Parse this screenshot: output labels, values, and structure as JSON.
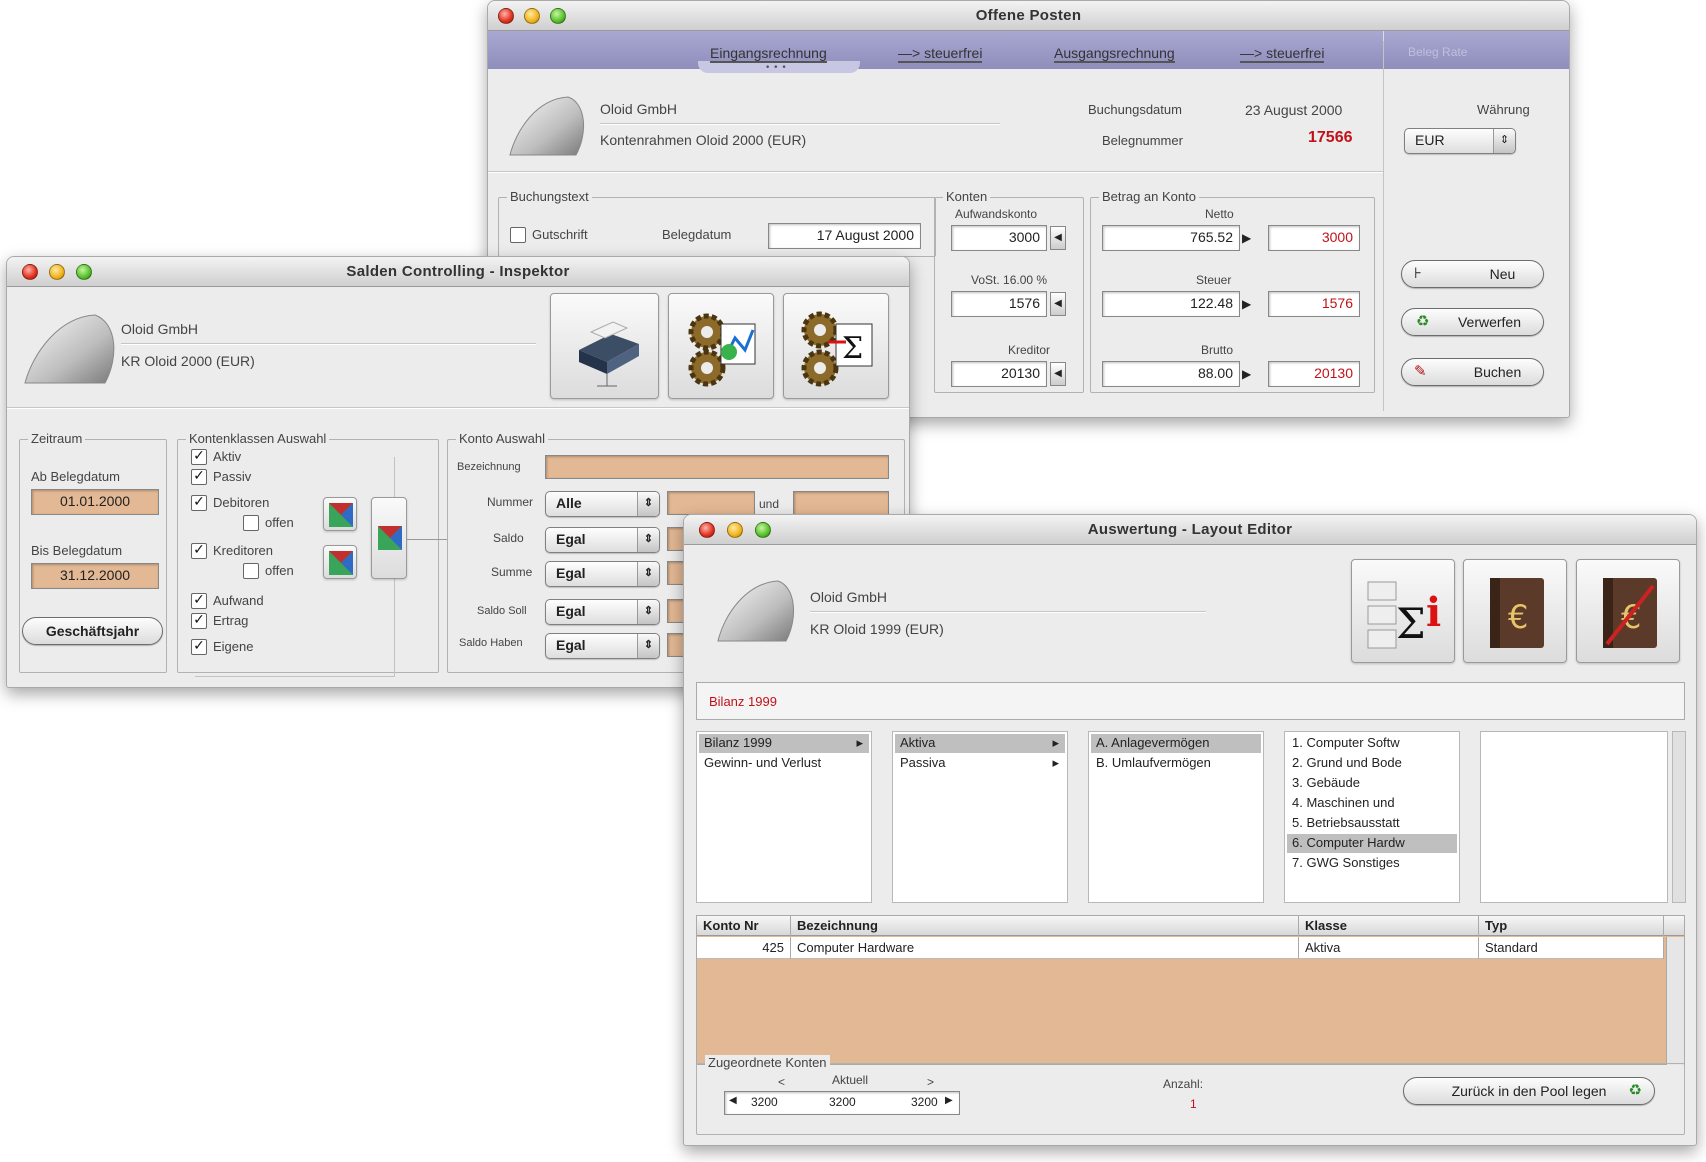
{
  "win1": {
    "title": "Offene Posten",
    "tabs": [
      "Eingangsrechnung",
      "—> steuerfrei",
      "Ausgangsrechnung",
      "—> steuerfrei"
    ],
    "tab_dim": "Beleg Rate",
    "tab_dots": "• • •",
    "company": "Oloid GmbH",
    "account_frame": "Kontenrahmen Oloid 2000 (EUR)",
    "booking_date_label": "Buchungsdatum",
    "booking_date": "23 August 2000",
    "doc_no_label": "Belegnummer",
    "doc_no": "17566",
    "currency_label": "Währung",
    "currency": "EUR",
    "buchungstext_label": "Buchungstext",
    "gutschrift_label": "Gutschrift",
    "belegdatum_label": "Belegdatum",
    "belegdatum": "17 August 2000",
    "konten_label": "Konten",
    "aufwandskonto_label": "Aufwandskonto",
    "aufwandskonto": "3000",
    "vorst_label": "VoSt. 16.00 %",
    "vorst": "1576",
    "kreditor_label": "Kreditor",
    "kreditor": "20130",
    "betrag_label": "Betrag an Konto",
    "netto_label": "Netto",
    "netto": "765.52",
    "netto_konto": "3000",
    "steuer_label": "Steuer",
    "steuer": "122.48",
    "steuer_konto": "1576",
    "brutto_label": "Brutto",
    "brutto": "88.00",
    "brutto_konto": "20130",
    "btn_neu": "Neu",
    "btn_verwerfen": "Verwerfen",
    "btn_buchen": "Buchen"
  },
  "win2": {
    "title": "Salden Controlling - Inspektor",
    "company": "Oloid GmbH",
    "account_frame": "KR Oloid 2000 (EUR)",
    "zeitraum_label": "Zeitraum",
    "ab_label": "Ab Belegdatum",
    "ab_value": "01.01.2000",
    "bis_label": "Bis Belegdatum",
    "bis_value": "31.12.2000",
    "btn_geschaeftsjahr": "Geschäftsjahr",
    "klassen_label": "Kontenklassen Auswahl",
    "chk_aktiv": "Aktiv",
    "chk_passiv": "Passiv",
    "chk_debitoren": "Debitoren",
    "chk_offen1": "offen",
    "chk_kreditoren": "Kreditoren",
    "chk_offen2": "offen",
    "chk_aufwand": "Aufwand",
    "chk_ertrag": "Ertrag",
    "chk_eigene": "Eigene",
    "konto_label": "Konto Auswahl",
    "bezeichnung_label": "Bezeichnung",
    "nummer_label": "Nummer",
    "nummer_popup": "Alle",
    "und_label": "und",
    "saldo_label": "Saldo",
    "saldo_popup": "Egal",
    "summe_label": "Summe",
    "summe_popup": "Egal",
    "saldo_soll_label": "Saldo Soll",
    "saldo_soll_popup": "Egal",
    "saldo_haben_label": "Saldo Haben",
    "saldo_haben_popup": "Egal"
  },
  "win3": {
    "title": "Auswertung - Layout Editor",
    "company": "Oloid GmbH",
    "account_frame": "KR Oloid 1999 (EUR)",
    "report_name": "Bilanz 1999",
    "col1": [
      "Bilanz 1999",
      "Gewinn- und Verlust"
    ],
    "col2": [
      "Aktiva",
      "Passiva"
    ],
    "col3": [
      "A.  Anlagevermögen",
      "B.  Umlaufvermögen"
    ],
    "col4": [
      "1.  Computer Softw",
      "2.  Grund und Bode",
      "3.  Gebäude",
      "4.  Maschinen und",
      "5.  Betriebsausstatt",
      "6.  Computer Hardw",
      "7.  GWG Sonstiges"
    ],
    "table_headers": [
      "Konto Nr",
      "Bezeichnung",
      "Klasse",
      "Typ"
    ],
    "table_rows": [
      [
        "425",
        "Computer Hardware",
        "Aktiva",
        "Standard"
      ]
    ],
    "zugeordnete_label": "Zugeordnete Konten",
    "nav_prev": "<",
    "nav_current": "Aktuell",
    "nav_next": ">",
    "nav_val1": "3200",
    "nav_val2": "3200",
    "nav_val3": "3200",
    "anzahl_label": "Anzahl:",
    "anzahl_value": "1",
    "btn_pool": "Zurück in den Pool legen"
  },
  "colors": {
    "accent_red": "#c1121a",
    "field_tan": "#e3b894",
    "tab_bar": "#9c9bc6"
  }
}
